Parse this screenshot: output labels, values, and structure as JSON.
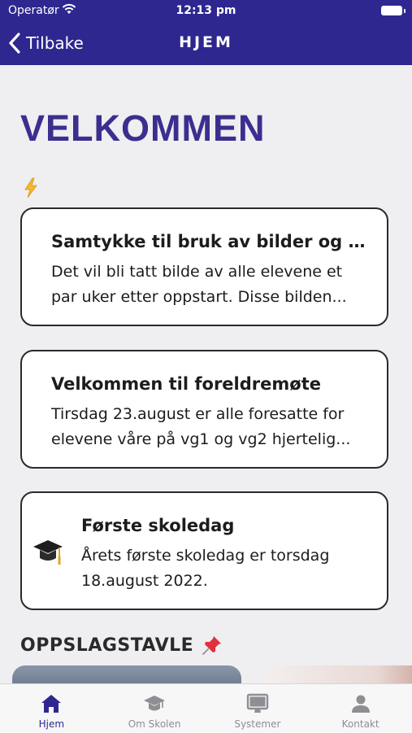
{
  "status_bar": {
    "carrier": "Operatør",
    "time": "12:13 pm"
  },
  "nav": {
    "back_label": "Tilbake",
    "title": "HJEM"
  },
  "welcome_heading": "VELKOMMEN",
  "cards": [
    {
      "title": "Samtykke til bruk av bilder og v...",
      "body": "Det vil bli tatt bilde av alle elevene et par uker etter oppstart. Disse bilden..."
    },
    {
      "title": "Velkommen til foreldremøte",
      "body": "Tirsdag 23.august er alle foresatte for elevene våre på vg1 og vg2 hjertelig..."
    },
    {
      "title": "Første skoledag",
      "body": "Årets første skoledag er torsdag 18.august 2022.",
      "icon": "graduation-cap-icon"
    }
  ],
  "bulletin": {
    "title": "OPPSLAGSTAVLE",
    "icon": "pushpin-icon"
  },
  "tabs": [
    {
      "label": "Hjem",
      "icon": "home-icon",
      "active": true
    },
    {
      "label": "Om Skolen",
      "icon": "graduation-cap-icon",
      "active": false
    },
    {
      "label": "Systemer",
      "icon": "monitor-icon",
      "active": false
    },
    {
      "label": "Kontakt",
      "icon": "person-icon",
      "active": false
    }
  ],
  "colors": {
    "brand": "#2e2790",
    "heading": "#3a2f8e",
    "inactive_tab": "#8e8e93"
  }
}
